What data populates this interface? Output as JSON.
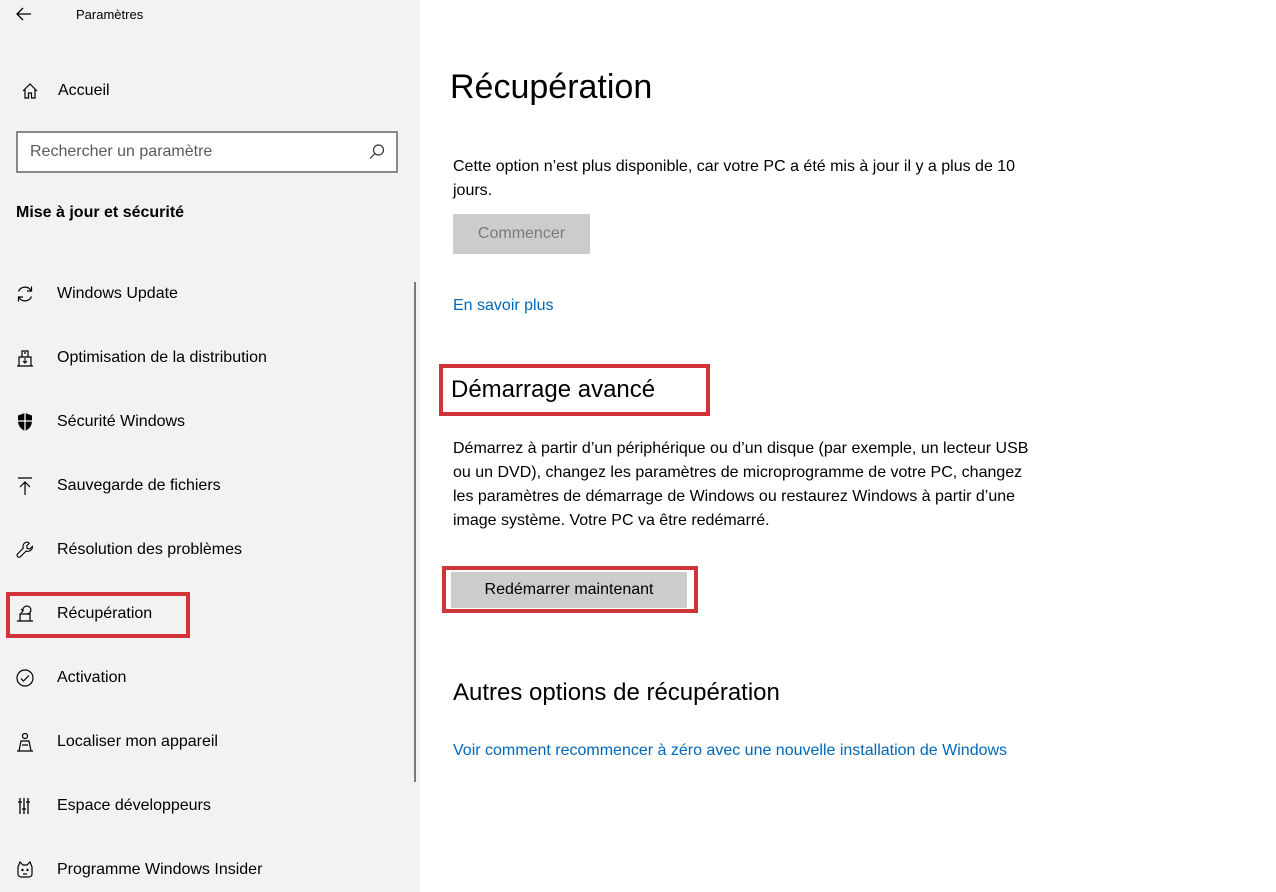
{
  "window": {
    "title": "Paramètres"
  },
  "sidebar": {
    "home_label": "Accueil",
    "search_placeholder": "Rechercher un paramètre",
    "section_title": "Mise à jour et sécurité",
    "items": [
      {
        "label": "Windows Update",
        "icon": "refresh-icon"
      },
      {
        "label": "Optimisation de la distribution",
        "icon": "delivery-optimization-icon"
      },
      {
        "label": "Sécurité Windows",
        "icon": "shield-icon"
      },
      {
        "label": "Sauvegarde de fichiers",
        "icon": "upload-arrow-icon"
      },
      {
        "label": "Résolution des problèmes",
        "icon": "wrench-icon"
      },
      {
        "label": "Récupération",
        "icon": "recovery-icon",
        "selected": true
      },
      {
        "label": "Activation",
        "icon": "check-circle-icon"
      },
      {
        "label": "Localiser mon appareil",
        "icon": "person-location-icon"
      },
      {
        "label": "Espace développeurs",
        "icon": "developer-icon"
      },
      {
        "label": "Programme Windows Insider",
        "icon": "insider-icon"
      }
    ]
  },
  "main": {
    "title": "Récupération",
    "reset_text": "Cette option n’est plus disponible, car votre PC a été mis à jour il y a plus de 10 jours.",
    "reset_button": "Commencer",
    "learn_more_link": "En savoir plus",
    "advanced_title": "Démarrage avancé",
    "advanced_text": "Démarrez à partir d’un périphérique ou d’un disque (par exemple, un lecteur USB ou un DVD), changez les paramètres de microprogramme de votre PC, changez les paramètres de démarrage de Windows ou restaurez Windows à partir d’une image système. Votre PC va être redémarré.",
    "restart_button": "Redémarrer maintenant",
    "other_title": "Autres options de récupération",
    "fresh_start_link": "Voir comment recommencer à zéro avec une nouvelle installation de Windows"
  },
  "colors": {
    "highlight": "#d13438",
    "link": "#0067b8",
    "sidebar_bg": "#f2f2f2"
  }
}
